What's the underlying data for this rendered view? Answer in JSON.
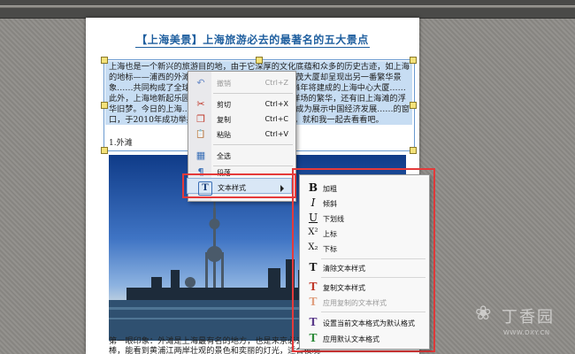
{
  "document": {
    "title": "【上海美景】上海旅游必去的最著名的五大景点",
    "intro": "上海也是一个新兴的旅游目的地，由于它深厚的文化底蕴和众多的历史古迹，如上海的地标——浦西的外滩……东方明珠广播电视塔与金茂大厦却呈现出另一番繁华景象……共同构成了全球最壮丽的天际线之一。而2014年将建成的上海中心大厦……此外，上海地新起乐园也将于2016年建成……十里洋场的繁华，还有旧上海滩的浮华旧梦。今日的上海……日新月异的都市面貌让上海成为展示中国经济发展……的窗口，于2010年成功举办了第41届世界博览会。下面，就和我一起去看看吧。",
    "heading": "1.外滩",
    "caption": "第一眼印象：外滩是上海最有名的地方，也是来京必去……太多历史的沉淀，夜晚很棒，能看到黄浦江两岸壮观的景色和奕丽的灯光，适合夜晚"
  },
  "context_menu": {
    "items": [
      {
        "label": "撤销",
        "key": "Ctrl+Z",
        "icon": "undo-icon",
        "glyph": "↶",
        "enabled": false
      },
      {
        "label": "剪切",
        "key": "Ctrl+X",
        "icon": "scissors-icon",
        "glyph": "✂",
        "enabled": true
      },
      {
        "label": "复制",
        "key": "Ctrl+C",
        "icon": "copy-icon",
        "glyph": "❐",
        "enabled": true
      },
      {
        "label": "粘贴",
        "key": "Ctrl+V",
        "icon": "paste-icon",
        "glyph": "📋",
        "enabled": true
      },
      {
        "label": "全选",
        "key": "",
        "icon": "select-all-icon",
        "glyph": "▦",
        "enabled": true
      },
      {
        "label": "段落...",
        "key": "",
        "icon": "paragraph-icon",
        "glyph": "¶",
        "enabled": true
      },
      {
        "label": "文本样式",
        "key": "",
        "icon": "text-style-icon",
        "glyph": "T",
        "enabled": true
      }
    ]
  },
  "submenu": {
    "items": [
      {
        "label": "加粗",
        "icon": "bold-icon",
        "glyph": "B",
        "enabled": true
      },
      {
        "label": "倾斜",
        "icon": "italic-icon",
        "glyph": "I",
        "enabled": true
      },
      {
        "label": "下划线",
        "icon": "underline-icon",
        "glyph": "U",
        "enabled": true
      },
      {
        "label": "上标",
        "icon": "superscript-icon",
        "glyph": "X²",
        "enabled": true
      },
      {
        "label": "下标",
        "icon": "subscript-icon",
        "glyph": "X₂",
        "enabled": true
      },
      {
        "label": "清除文本样式",
        "icon": "clear-style-icon",
        "glyph": "T",
        "enabled": true
      },
      {
        "label": "复制文本样式",
        "icon": "copy-style-icon",
        "glyph": "T",
        "enabled": true
      },
      {
        "label": "应用复制的文本样式",
        "icon": "apply-copied-style-icon",
        "glyph": "T",
        "enabled": false
      },
      {
        "label": "设置当前文本格式为默认格式",
        "icon": "set-default-style-icon",
        "glyph": "T",
        "enabled": true
      },
      {
        "label": "应用默认文本格式",
        "icon": "apply-default-style-icon",
        "glyph": "T",
        "enabled": true
      }
    ]
  },
  "watermark": {
    "text": "丁香园",
    "url": "WWW.DXY.CN"
  },
  "colors": {
    "highlight": "#e53a3a",
    "title": "#1f5f9f",
    "selection": "#c7ddf3"
  }
}
